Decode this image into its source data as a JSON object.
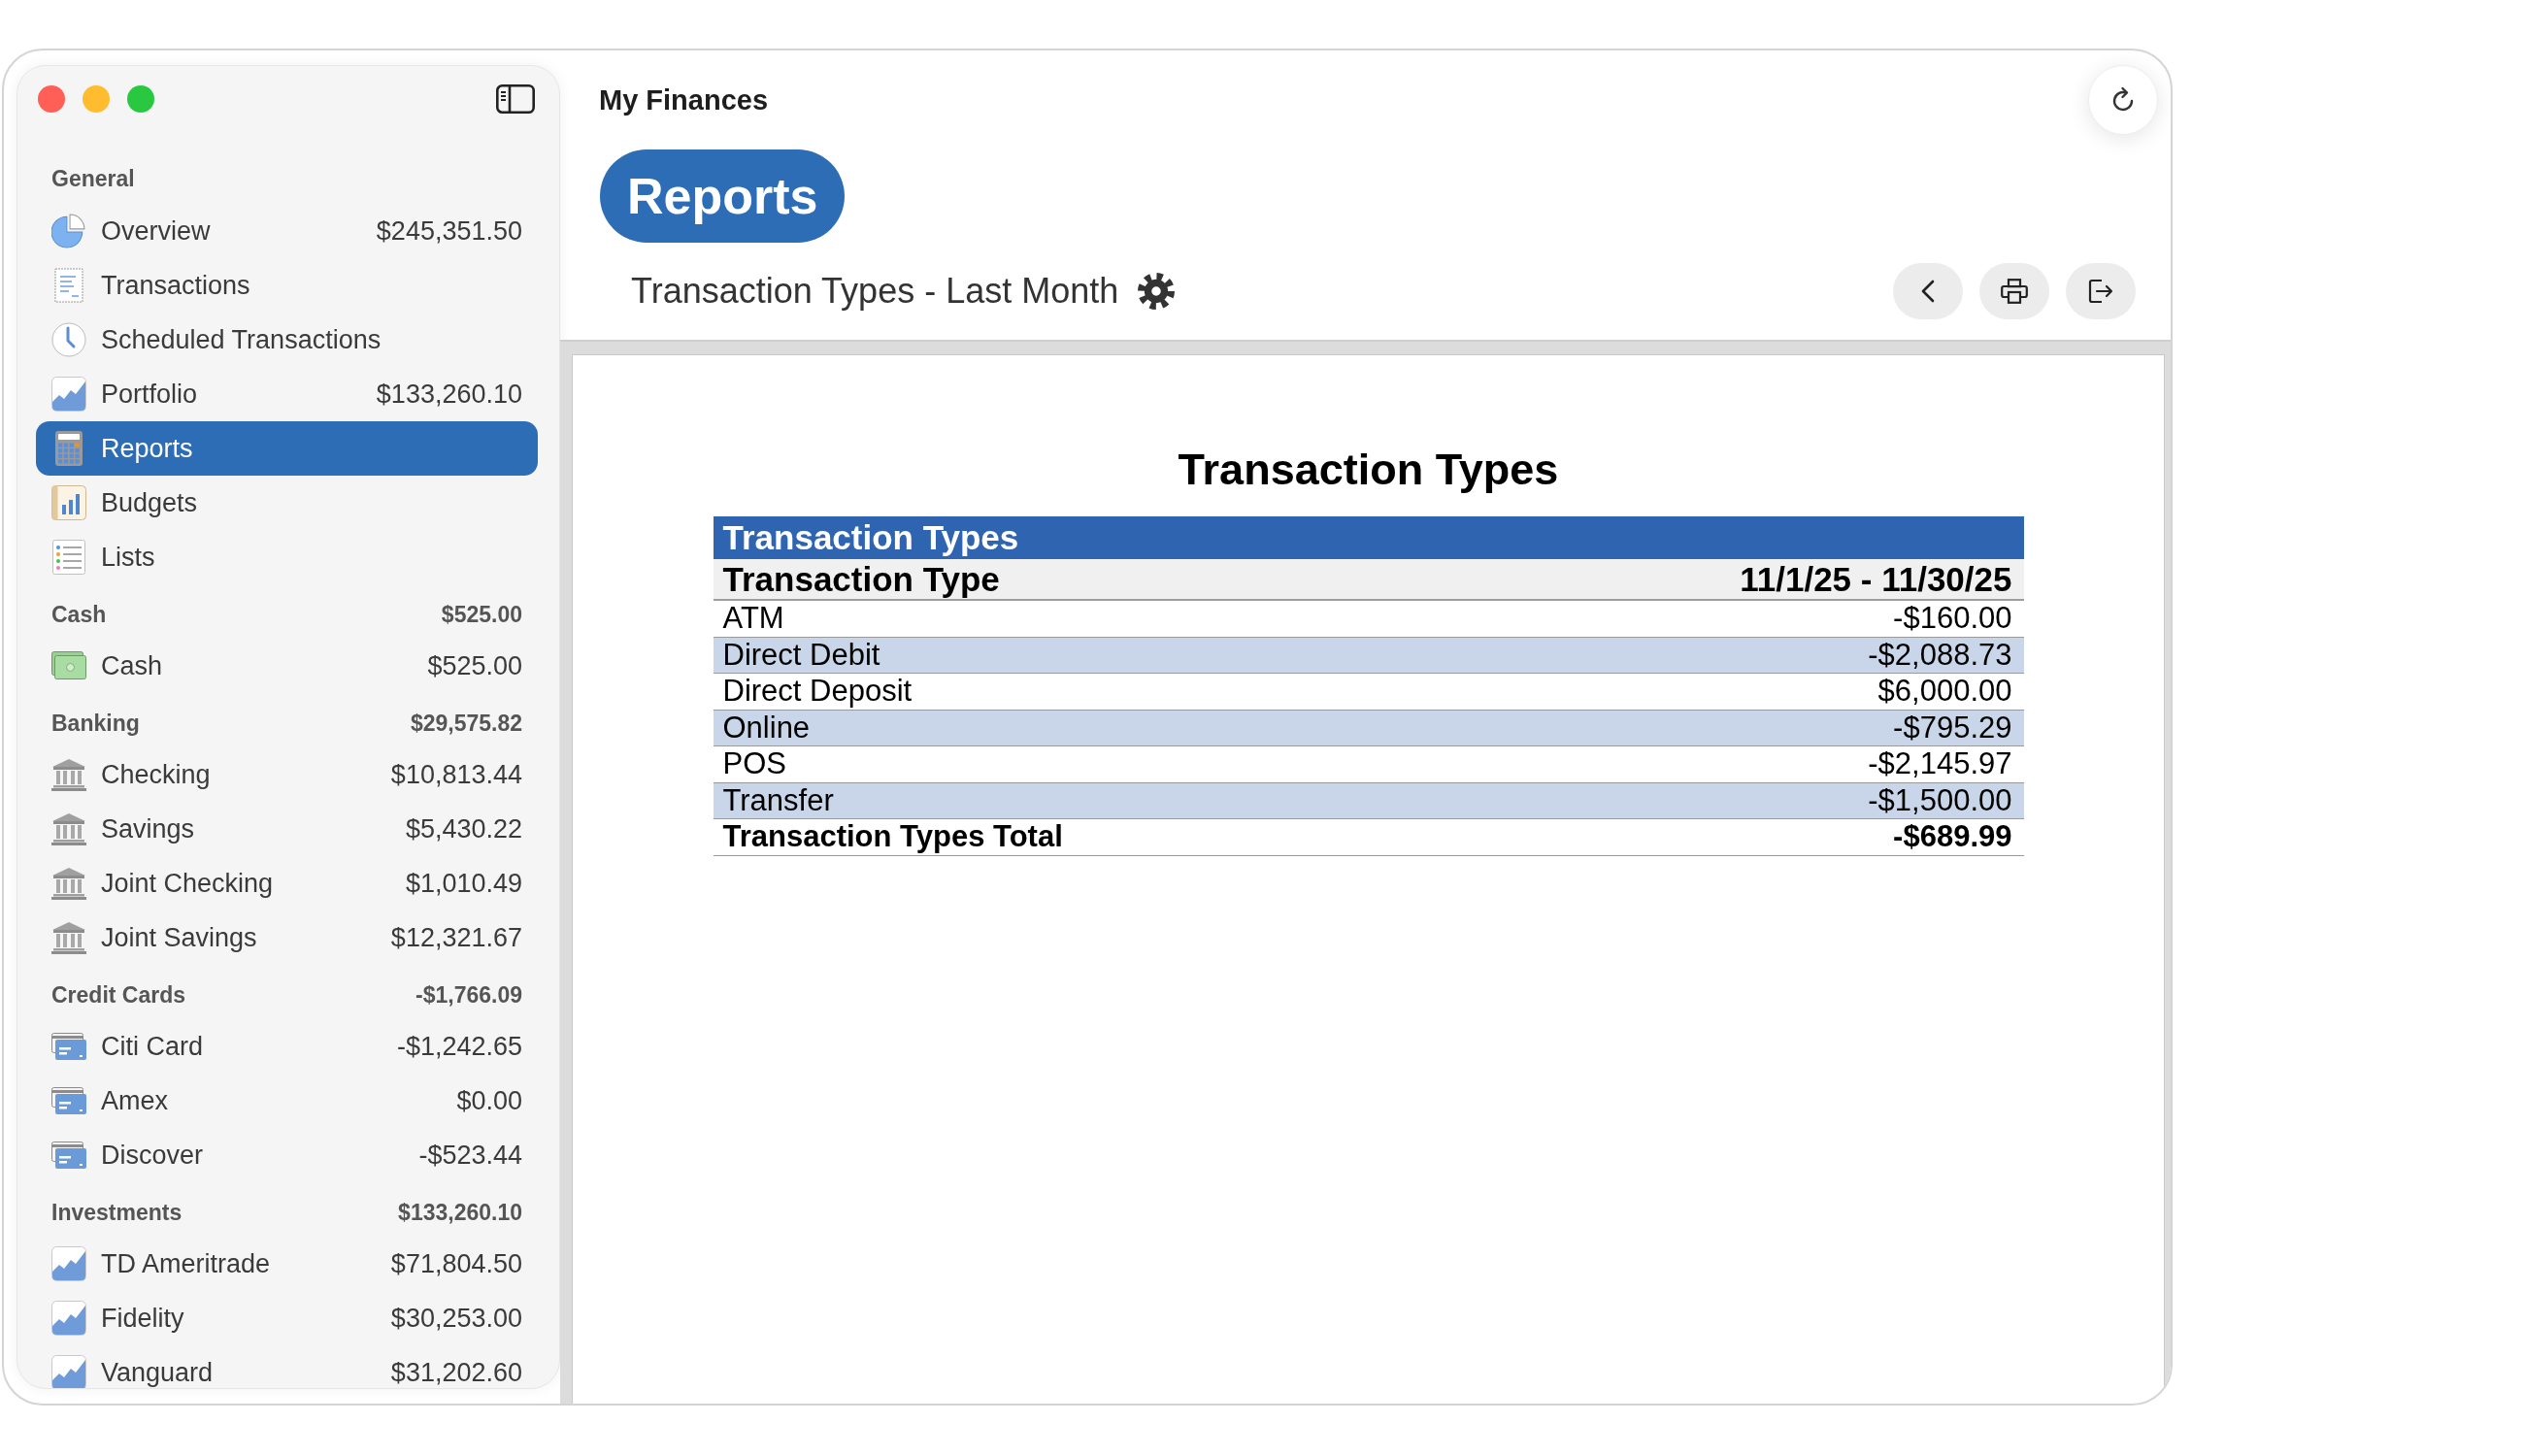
{
  "window": {
    "title": "My Finances"
  },
  "sidebar": {
    "sections": [
      {
        "title": "General",
        "items": [
          {
            "kind": "pie",
            "label": "Overview",
            "amount": "$245,351.50",
            "selected": false
          },
          {
            "kind": "receipt",
            "label": "Transactions",
            "selected": false
          },
          {
            "kind": "clock",
            "label": "Scheduled Transactions",
            "selected": false
          },
          {
            "kind": "chart",
            "label": "Portfolio",
            "amount": "$133,260.10",
            "selected": false
          },
          {
            "kind": "calculator",
            "label": "Reports",
            "selected": true
          },
          {
            "kind": "budget",
            "label": "Budgets",
            "selected": false
          },
          {
            "kind": "list",
            "label": "Lists",
            "selected": false
          }
        ]
      },
      {
        "title": "Cash",
        "total": "$525.00",
        "items": [
          {
            "kind": "cash",
            "label": "Cash",
            "amount": "$525.00",
            "selected": false
          }
        ]
      },
      {
        "title": "Banking",
        "total": "$29,575.82",
        "items": [
          {
            "kind": "bank",
            "label": "Checking",
            "amount": "$10,813.44",
            "selected": false
          },
          {
            "kind": "bank",
            "label": "Savings",
            "amount": "$5,430.22",
            "selected": false
          },
          {
            "kind": "bank",
            "label": "Joint Checking",
            "amount": "$1,010.49",
            "selected": false
          },
          {
            "kind": "bank",
            "label": "Joint Savings",
            "amount": "$12,321.67",
            "selected": false
          }
        ]
      },
      {
        "title": "Credit Cards",
        "total": "-$1,766.09",
        "items": [
          {
            "kind": "card",
            "label": "Citi Card",
            "amount": "-$1,242.65",
            "selected": false
          },
          {
            "kind": "card",
            "label": "Amex",
            "amount": "$0.00",
            "selected": false
          },
          {
            "kind": "card",
            "label": "Discover",
            "amount": "-$523.44",
            "selected": false
          }
        ]
      },
      {
        "title": "Investments",
        "total": "$133,260.10",
        "items": [
          {
            "kind": "chart",
            "label": "TD Ameritrade",
            "amount": "$71,804.50",
            "selected": false
          },
          {
            "kind": "chart",
            "label": "Fidelity",
            "amount": "$30,253.00",
            "selected": false
          },
          {
            "kind": "chart",
            "label": "Vanguard",
            "amount": "$31,202.60",
            "selected": false
          }
        ]
      }
    ]
  },
  "header": {
    "page_title": "Reports",
    "report_name": "Transaction Types - Last Month"
  },
  "report": {
    "title": "Transaction Types",
    "table": {
      "group": "Transaction Types",
      "columns": [
        "Transaction Type",
        "11/1/25 - 11/30/25"
      ],
      "rows": [
        {
          "kind": "data",
          "cells": [
            "ATM",
            "-$160.00"
          ]
        },
        {
          "kind": "data",
          "cells": [
            "Direct Debit",
            "-$2,088.73"
          ]
        },
        {
          "kind": "data",
          "cells": [
            "Direct Deposit",
            "$6,000.00"
          ]
        },
        {
          "kind": "data",
          "cells": [
            "Online",
            "-$795.29"
          ]
        },
        {
          "kind": "data",
          "cells": [
            "POS",
            "-$2,145.97"
          ]
        },
        {
          "kind": "data",
          "cells": [
            "Transfer",
            "-$1,500.00"
          ]
        },
        {
          "kind": "total",
          "cells": [
            "Transaction Types Total",
            "-$689.99"
          ]
        }
      ]
    }
  }
}
